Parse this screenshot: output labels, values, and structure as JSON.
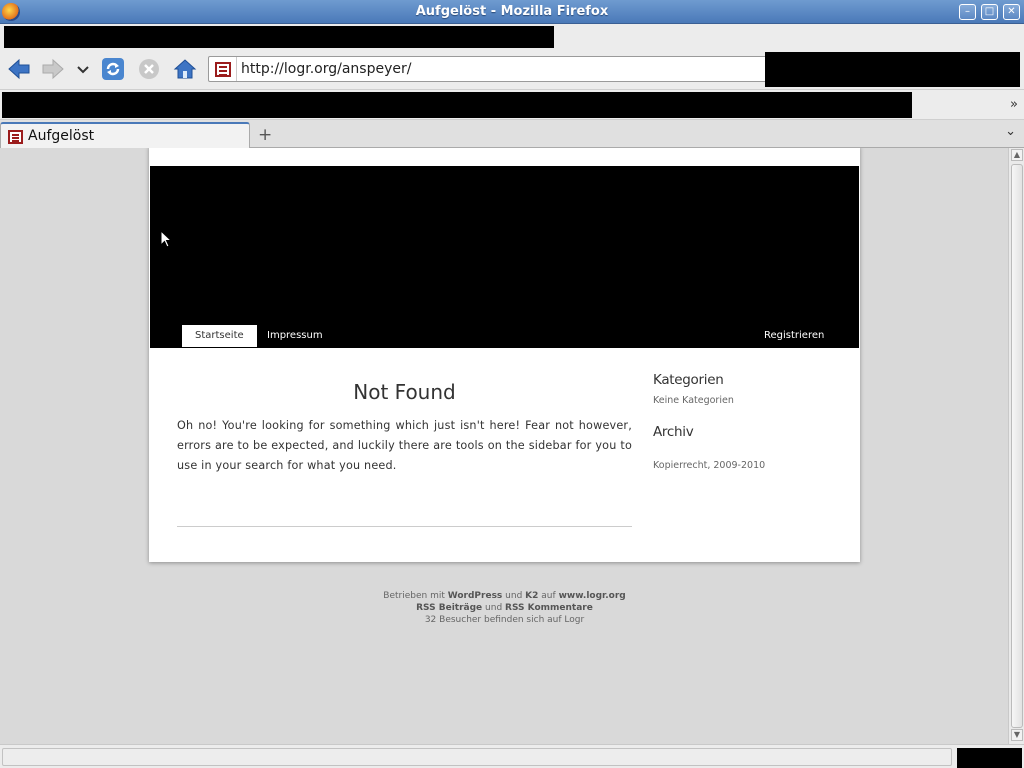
{
  "window": {
    "title": "Aufgelöst - Mozilla Firefox",
    "minimize": "–",
    "maximize": "□",
    "close": "✕"
  },
  "toolbar": {
    "url": "http://logr.org/anspeyer/"
  },
  "bookmarks": {
    "overflow": "»"
  },
  "tabs": [
    {
      "label": "Aufgelöst",
      "active": true
    }
  ],
  "tabbar": {
    "new_tab": "+",
    "list": "⌄"
  },
  "page": {
    "menu": {
      "home": "Startseite",
      "imprint": "Impressum",
      "register": "Registrieren"
    },
    "heading": "Not Found",
    "body": "Oh no! You're looking for something which just isn't here! Fear not however, errors are to be expected, and luckily there are tools on the sidebar for you to use in your search for what you need.",
    "sidebar": {
      "categories_title": "Kategorien",
      "categories_empty": "Keine Kategorien",
      "archive_title": "Archiv",
      "copyright": "Kopierrecht, 2009-2010"
    },
    "footer": {
      "powered_prefix": "Betrieben mit",
      "wordpress": "WordPress",
      "and1": "und",
      "k2": "K2",
      "on": "auf",
      "site": "www.logr.org",
      "rss_posts": "RSS Beiträge",
      "and2": "und",
      "rss_comments": "RSS Kommentare",
      "visitors": "32 Besucher befinden sich auf Logr"
    }
  },
  "icons": {
    "back": "back-arrow-icon",
    "forward": "forward-arrow-icon",
    "reload": "reload-icon",
    "stop": "stop-icon",
    "home": "home-icon"
  },
  "colors": {
    "titlebar": "#4a79b8",
    "header": "#000000",
    "favicon": "#9b1c1c"
  }
}
